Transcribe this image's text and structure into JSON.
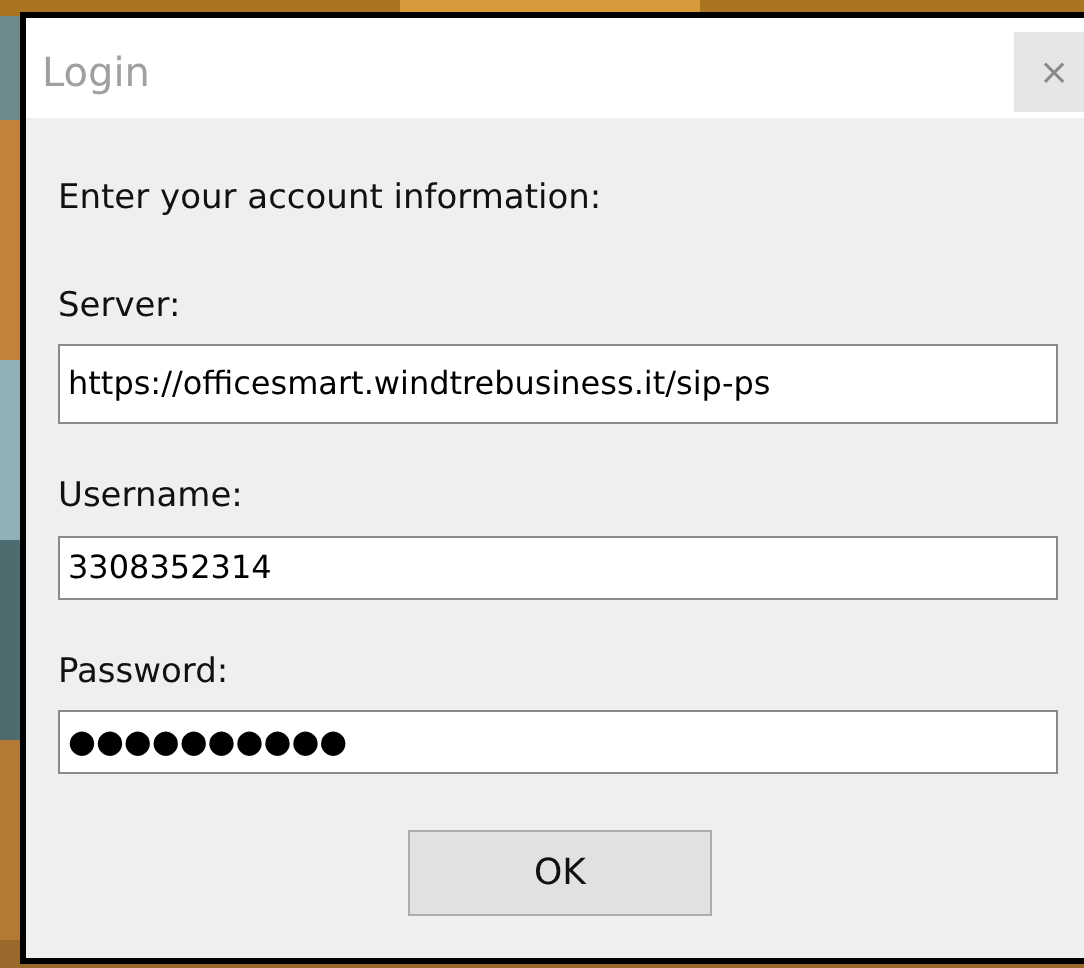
{
  "window": {
    "title": "Login",
    "close": "×"
  },
  "prompt": "Enter your account information:",
  "fields": [
    {
      "label": "Server:",
      "value": "https://officesmart.windtrebusiness.it/sip-ps"
    },
    {
      "label": "Username:",
      "value": "3308352314"
    },
    {
      "label": "Password:",
      "value": "●●●●●●●●●●"
    }
  ],
  "buttons": [
    "OK"
  ]
}
